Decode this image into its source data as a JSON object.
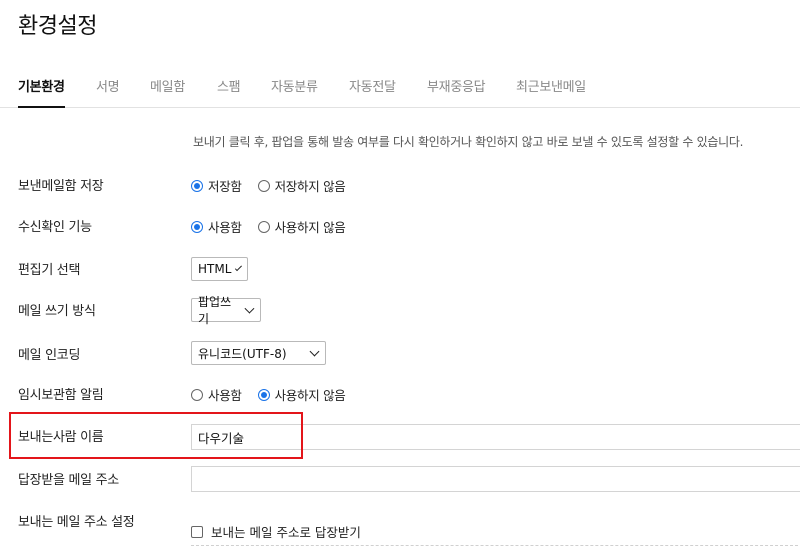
{
  "page_title": "환경설정",
  "tabs": [
    {
      "label": "기본환경",
      "active": true
    },
    {
      "label": "서명",
      "active": false
    },
    {
      "label": "메일함",
      "active": false
    },
    {
      "label": "스팸",
      "active": false
    },
    {
      "label": "자동분류",
      "active": false
    },
    {
      "label": "자동전달",
      "active": false
    },
    {
      "label": "부재중응답",
      "active": false
    },
    {
      "label": "최근보낸메일",
      "active": false
    }
  ],
  "send_confirm": {
    "description": "보내기 클릭 후, 팝업을 통해 발송 여부를 다시 확인하거나 확인하지 않고 바로 보낼 수 있도록 설정할 수 있습니다."
  },
  "save_sent": {
    "label": "보낸메일함 저장",
    "options": [
      "저장함",
      "저장하지 않음"
    ],
    "selected": "저장함"
  },
  "read_receipt": {
    "label": "수신확인 기능",
    "options": [
      "사용함",
      "사용하지 않음"
    ],
    "selected": "사용함"
  },
  "editor": {
    "label": "편집기 선택",
    "value": "HTML"
  },
  "compose_mode": {
    "label": "메일 쓰기 방식",
    "value": "팝업쓰기"
  },
  "encoding": {
    "label": "메일 인코딩",
    "value": "유니코드(UTF-8)"
  },
  "draft_alert": {
    "label": "임시보관함 알림",
    "options": [
      "사용함",
      "사용하지 않음"
    ],
    "selected": "사용하지 않음"
  },
  "sender_name": {
    "label": "보내는사람 이름",
    "value": "다우기술"
  },
  "reply_to": {
    "label": "답장받을 메일 주소",
    "value": ""
  },
  "sender_address": {
    "label": "보내는 메일 주소 설정",
    "checkbox_label": "보내는 메일 주소로 답장받기",
    "checked": false
  },
  "colors": {
    "accent": "#1a73e8",
    "highlight": "#e3151a"
  }
}
